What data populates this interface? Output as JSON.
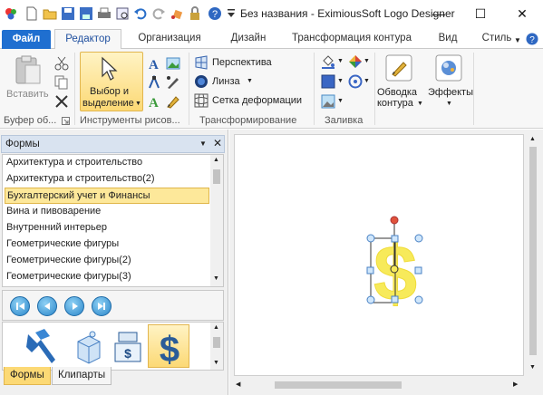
{
  "window": {
    "title": "Без названия - EximiousSoft Logo Designer",
    "minimize_glyph": "—",
    "maximize_glyph": "☐",
    "close_glyph": "✕"
  },
  "tabs": {
    "file": "Файл",
    "items": [
      "Редактор",
      "Организация",
      "Дизайн",
      "Трансформация контура",
      "Вид"
    ],
    "style_label": "Стиль",
    "help_glyph": "?"
  },
  "ribbon": {
    "clipboard": {
      "paste_label": "Вставить",
      "group_label": "Буфер об..."
    },
    "tools": {
      "select_label_1": "Выбор и",
      "select_label_2": "выделение",
      "group_label": "Инструменты рисов..."
    },
    "transform": {
      "perspective": "Перспектива",
      "lens": "Линза",
      "mesh": "Сетка деформации",
      "group_label": "Трансформирование"
    },
    "fill": {
      "group_label": "Заливка"
    },
    "outline": {
      "label_1": "Обводка",
      "label_2": "контура"
    },
    "effects": {
      "label": "Эффекты"
    }
  },
  "panel": {
    "title": "Формы",
    "items": [
      "Архитектура и строительство",
      "Архитектура и строительство(2)",
      "Бухгалтерский учет и Финансы",
      "Вина и пивоварение",
      "Внутренний интерьер",
      "Геометрические фигуры",
      "Геометрические фигуры(2)",
      "Геометрические фигуры(3)"
    ],
    "selected_index": 2,
    "bottom_tabs": [
      "Формы",
      "Клипарты"
    ]
  },
  "colors": {
    "accent": "#1f6fd0",
    "selection_fill": "#fde89a",
    "dollar_yellow": "#f7ea5a",
    "handle_red": "#e0523b"
  }
}
